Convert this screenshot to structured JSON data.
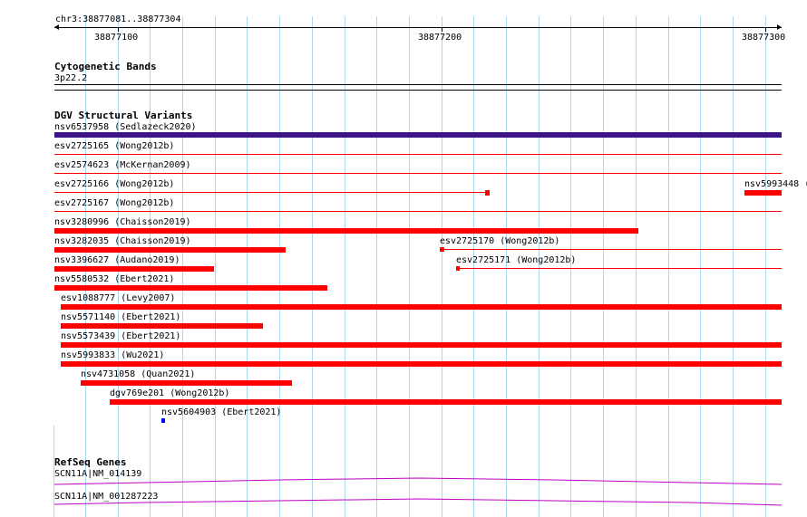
{
  "ruler": {
    "range_label": "chr3:38877081..38877304",
    "ticks": [
      "38877100",
      "38877200",
      "38877300"
    ]
  },
  "cytobands": {
    "title": "Cytogenetic Bands",
    "band": "3p22.2"
  },
  "dgv": {
    "title": "DGV Structural Variants",
    "features": [
      {
        "label": "nsv6537958 (Sedlazeck2020)",
        "color": "#3d1486"
      },
      {
        "label": "esv2725165 (Wong2012b)",
        "color": "#ff0000"
      },
      {
        "label": "esv2574623 (McKernan2009)",
        "color": "#ff0000"
      },
      {
        "label": "esv2725166 (Wong2012b)",
        "color": "#ff0000"
      },
      {
        "label": "nsv5993448 (",
        "color": "#ff0000"
      },
      {
        "label": "esv2725167 (Wong2012b)",
        "color": "#ff0000"
      },
      {
        "label": "nsv3280996 (Chaisson2019)",
        "color": "#ff0000"
      },
      {
        "label": "nsv3282035 (Chaisson2019)",
        "color": "#ff0000"
      },
      {
        "label": "esv2725170 (Wong2012b)",
        "color": "#ff0000"
      },
      {
        "label": "nsv3396627 (Audano2019)",
        "color": "#ff0000"
      },
      {
        "label": "esv2725171 (Wong2012b)",
        "color": "#ff0000"
      },
      {
        "label": "nsv5580532 (Ebert2021)",
        "color": "#ff0000"
      },
      {
        "label": "esv1088777 (Levy2007)",
        "color": "#ff0000"
      },
      {
        "label": "nsv5571140 (Ebert2021)",
        "color": "#ff0000"
      },
      {
        "label": "nsv5573439 (Ebert2021)",
        "color": "#ff0000"
      },
      {
        "label": "nsv5993833 (Wu2021)",
        "color": "#ff0000"
      },
      {
        "label": "nsv4731058 (Quan2021)",
        "color": "#ff0000"
      },
      {
        "label": "dgv769e201 (Wong2012b)",
        "color": "#ff0000"
      },
      {
        "label": "nsv5604903 (Ebert2021)",
        "color": "#0000ff"
      }
    ]
  },
  "refseq": {
    "title": "RefSeq Genes",
    "genes": [
      {
        "label": "SCN11A|NM_014139",
        "color": "#c000c0"
      },
      {
        "label": "SCN11A|NM_001287223",
        "color": "#c000c0"
      }
    ]
  }
}
